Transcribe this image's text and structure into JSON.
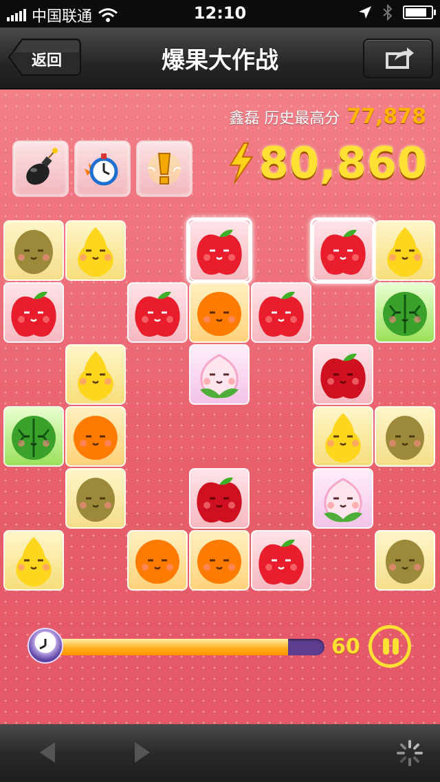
{
  "status_bar": {
    "carrier": "中国联通",
    "time": "12:10"
  },
  "nav": {
    "back_label": "返回",
    "title": "爆果大作战"
  },
  "game": {
    "best_label": "鑫磊 历史最高分",
    "best_score": "77,878",
    "score": "80,860",
    "powerups": [
      "bomb-icon",
      "stopwatch-icon",
      "hint-icon"
    ],
    "timer_value": "60",
    "timer_fraction": 0.87
  },
  "board": [
    {
      "r": 0,
      "c": 0,
      "fruit": "kiwi"
    },
    {
      "r": 0,
      "c": 1,
      "fruit": "pear"
    },
    {
      "r": 0,
      "c": 3,
      "fruit": "apple",
      "selected": true
    },
    {
      "r": 0,
      "c": 5,
      "fruit": "apple",
      "selected": true
    },
    {
      "r": 0,
      "c": 6,
      "fruit": "pear"
    },
    {
      "r": 1,
      "c": 0,
      "fruit": "apple"
    },
    {
      "r": 1,
      "c": 2,
      "fruit": "apple"
    },
    {
      "r": 1,
      "c": 3,
      "fruit": "orange"
    },
    {
      "r": 1,
      "c": 4,
      "fruit": "apple"
    },
    {
      "r": 1,
      "c": 6,
      "fruit": "watermelon"
    },
    {
      "r": 2,
      "c": 1,
      "fruit": "pear"
    },
    {
      "r": 2,
      "c": 3,
      "fruit": "peach"
    },
    {
      "r": 2,
      "c": 5,
      "fruit": "redapple"
    },
    {
      "r": 3,
      "c": 0,
      "fruit": "watermelon"
    },
    {
      "r": 3,
      "c": 1,
      "fruit": "orange"
    },
    {
      "r": 3,
      "c": 5,
      "fruit": "pear"
    },
    {
      "r": 3,
      "c": 6,
      "fruit": "kiwi"
    },
    {
      "r": 4,
      "c": 1,
      "fruit": "kiwi"
    },
    {
      "r": 4,
      "c": 3,
      "fruit": "redapple"
    },
    {
      "r": 4,
      "c": 5,
      "fruit": "peach"
    },
    {
      "r": 5,
      "c": 0,
      "fruit": "pear"
    },
    {
      "r": 5,
      "c": 2,
      "fruit": "orange"
    },
    {
      "r": 5,
      "c": 3,
      "fruit": "orange"
    },
    {
      "r": 5,
      "c": 4,
      "fruit": "apple"
    },
    {
      "r": 5,
      "c": 6,
      "fruit": "kiwi"
    }
  ],
  "colors": {
    "accent": "#ffe033",
    "board_bg": "#ec6b76",
    "timer_track": "#5c3d8f"
  }
}
